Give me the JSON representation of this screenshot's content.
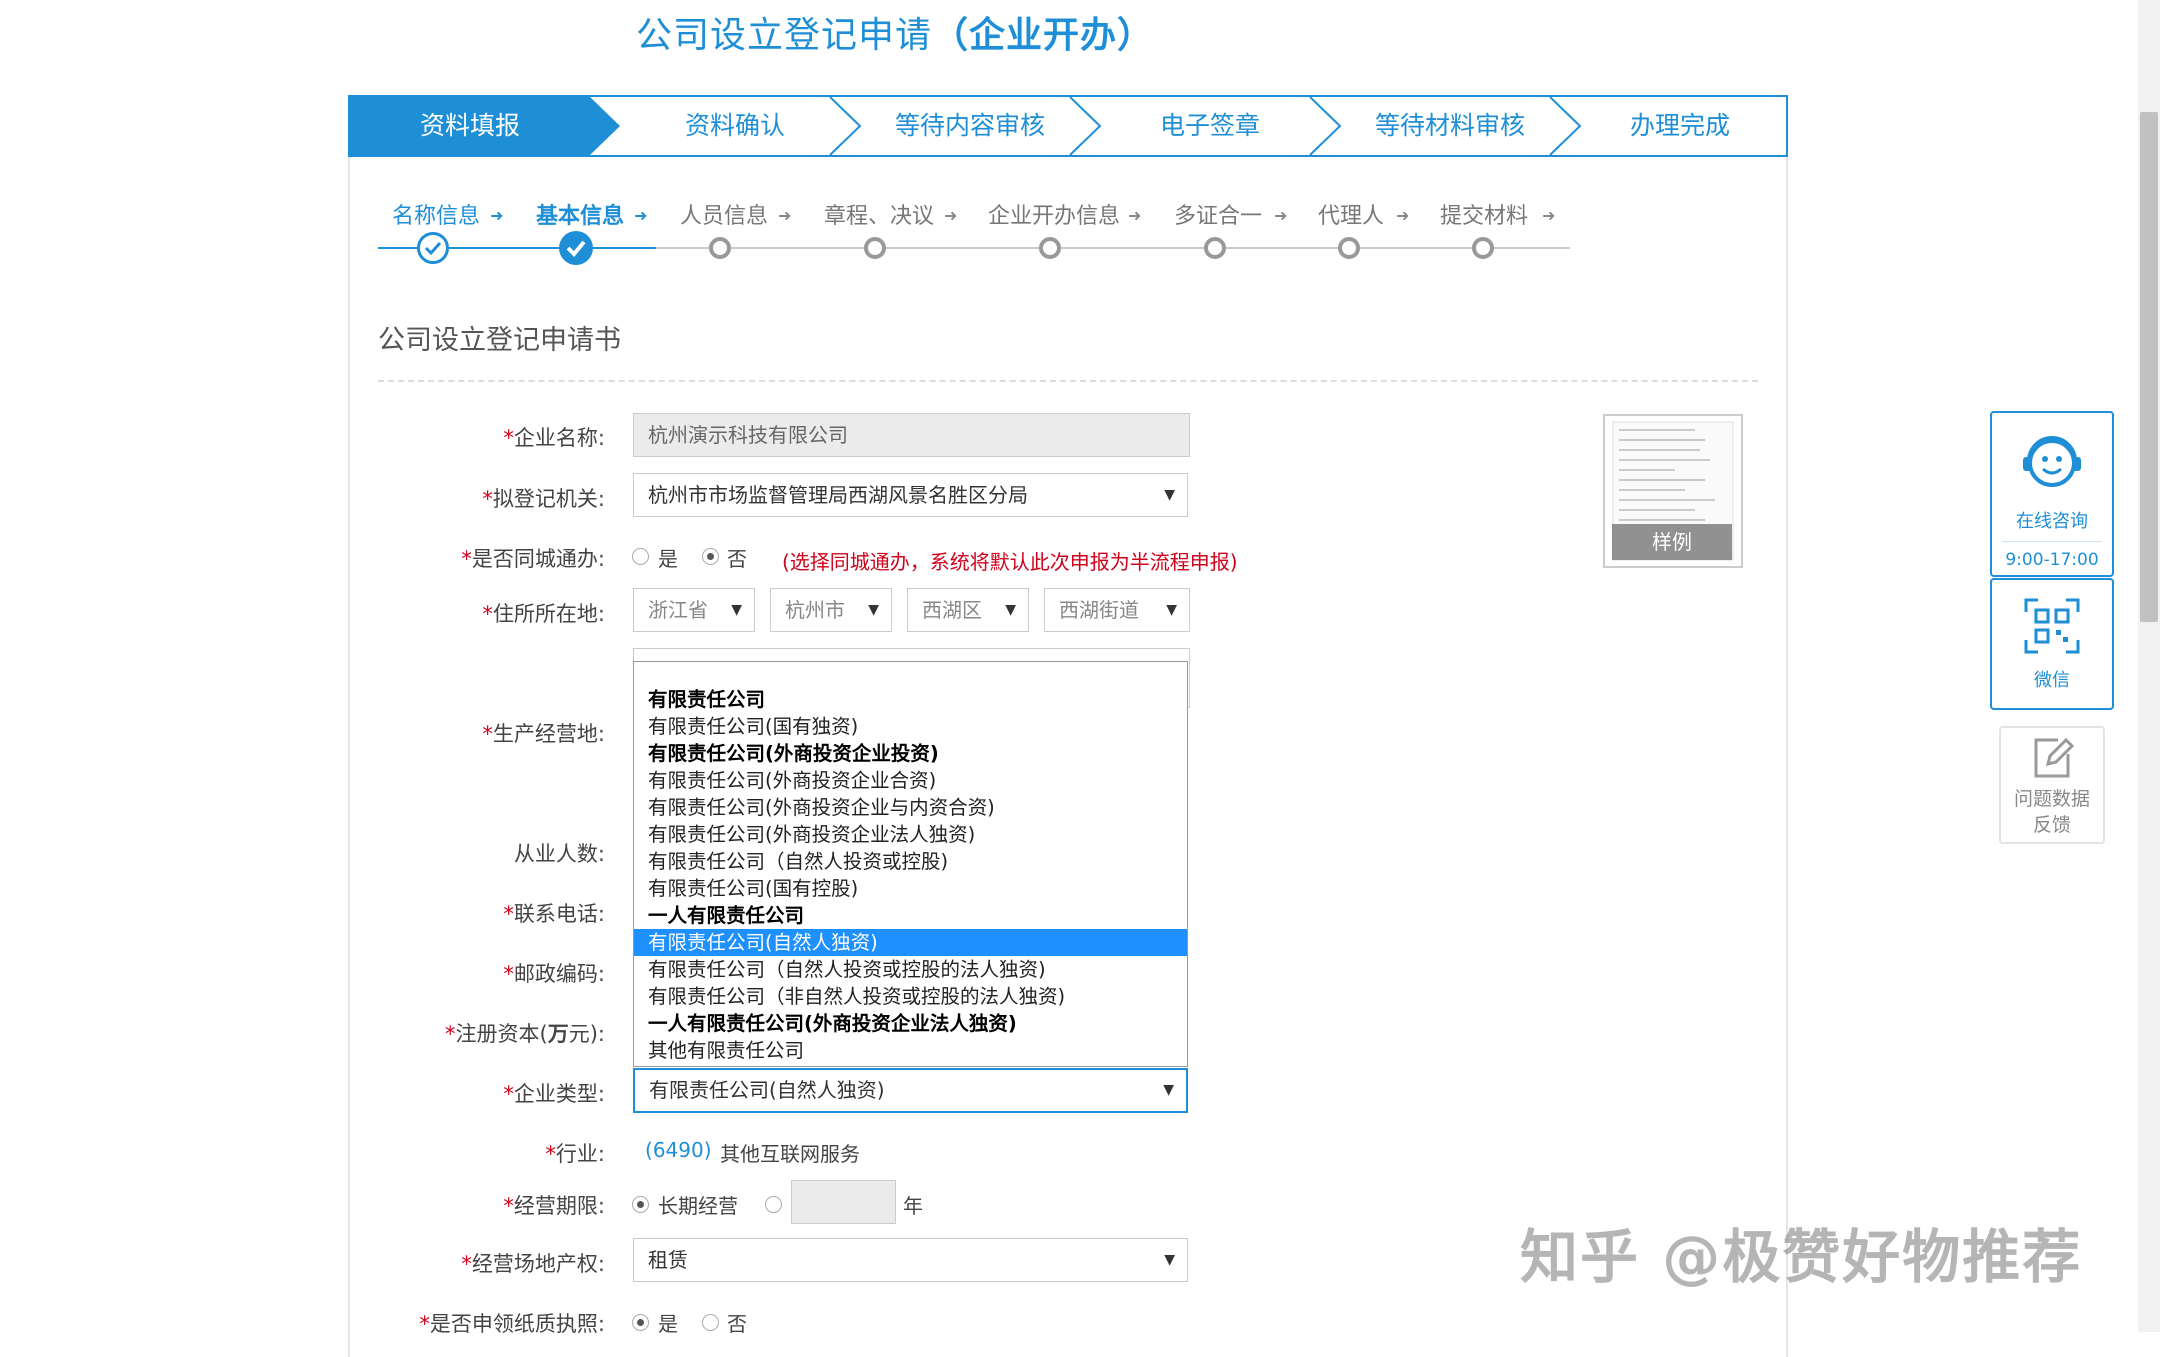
{
  "title_main": "公司设立登记申请",
  "title_bold": "（企业开办）",
  "steps": [
    "资料填报",
    "资料确认",
    "等待内容审核",
    "电子签章",
    "等待材料审核",
    "办理完成"
  ],
  "substeps": [
    "名称信息",
    "基本信息",
    "人员信息",
    "章程、决议",
    "企业开办信息",
    "多证合一",
    "代理人",
    "提交材料"
  ],
  "form_heading": "公司设立登记申请书",
  "labels": {
    "name": "企业名称:",
    "authority": "拟登记机关:",
    "same_city": "是否同城通办:",
    "address": "住所所在地:",
    "business_place": "生产经营地:",
    "employees": "从业人数:",
    "phone": "联系电话:",
    "postcode": "邮政编码:",
    "capital_pre": "注册资本(",
    "capital_bold": "万",
    "capital_post": "元):",
    "type": "企业类型:",
    "industry": "行业:",
    "term": "经营期限:",
    "property": "经营场地产权:",
    "paper": "是否申领纸质执照:"
  },
  "values": {
    "name": "杭州演示科技有限公司",
    "authority": "杭州市市场监督管理局西湖风景名胜区分局",
    "yes": "是",
    "no": "否",
    "same_city_tip": "(选择同城通办，系统将默认此次申报为半流程申报)",
    "province": "浙江省",
    "city": "杭州市",
    "district": "西湖区",
    "street": "西湖街道",
    "type": "有限责任公司(自然人独资)",
    "industry_code": "6490",
    "industry_name": "其他互联网服务",
    "term_long": "长期经营",
    "term_year": "年",
    "property": "租赁"
  },
  "dropdown_options": [
    {
      "text": "有限责任公司",
      "bold": true
    },
    {
      "text": "有限责任公司(国有独资)",
      "bold": false
    },
    {
      "text": "有限责任公司(外商投资企业投资)",
      "bold": true
    },
    {
      "text": "有限责任公司(外商投资企业合资)",
      "bold": false
    },
    {
      "text": "有限责任公司(外商投资企业与内资合资)",
      "bold": false
    },
    {
      "text": "有限责任公司(外商投资企业法人独资)",
      "bold": false
    },
    {
      "text": "有限责任公司（自然人投资或控股)",
      "bold": false
    },
    {
      "text": "有限责任公司(国有控股)",
      "bold": false
    },
    {
      "text": "一人有限责任公司",
      "bold": true
    },
    {
      "text": "有限责任公司(自然人独资)",
      "bold": false,
      "selected": true
    },
    {
      "text": "有限责任公司（自然人投资或控股的法人独资)",
      "bold": false
    },
    {
      "text": "有限责任公司（非自然人投资或控股的法人独资)",
      "bold": false
    },
    {
      "text": "一人有限责任公司(外商投资企业法人独资)",
      "bold": true
    },
    {
      "text": "其他有限责任公司",
      "bold": false
    }
  ],
  "sample_label": "样例",
  "side": {
    "consult": "在线咨询",
    "hours": "9:00-17:00",
    "wechat": "微信",
    "feedback_1": "问题数据",
    "feedback_2": "反馈"
  },
  "watermark": "知乎 @极赞好物推荐",
  "colors": {
    "accent": "#1e8fd6",
    "required": "#d0021b",
    "selected_option": "#1e90ff"
  }
}
